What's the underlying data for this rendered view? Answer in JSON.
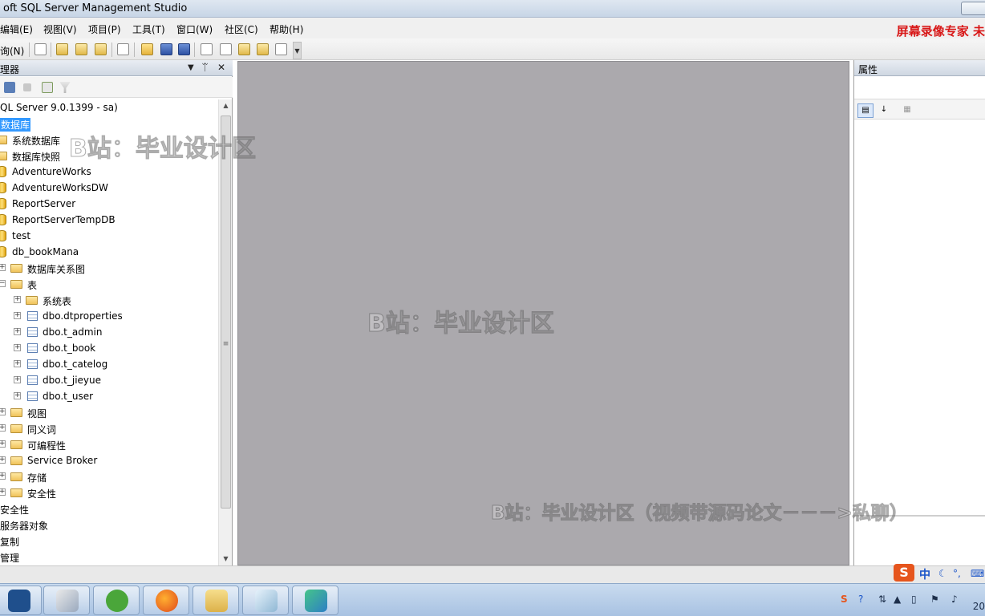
{
  "window": {
    "title": "oft SQL Server Management Studio"
  },
  "menu": {
    "items": [
      "编辑(E)",
      "视图(V)",
      "项目(P)",
      "工具(T)",
      "窗口(W)",
      "社区(C)",
      "帮助(H)"
    ],
    "promo": "屏幕录像专家 未"
  },
  "toolbar": {
    "query_label": "询(N)"
  },
  "explorer": {
    "title": "理器",
    "controls": {
      "dropdown": "▼",
      "pin": "ᛠ",
      "close": "✕"
    },
    "tree": [
      {
        "text": "QL Server 9.0.1399 - sa)"
      },
      {
        "text": "数据库"
      },
      {
        "text": "系统数据库"
      },
      {
        "text": "数据库快照"
      },
      {
        "text": "AdventureWorks"
      },
      {
        "text": "AdventureWorksDW"
      },
      {
        "text": "ReportServer"
      },
      {
        "text": "ReportServerTempDB"
      },
      {
        "text": "test"
      },
      {
        "text": "db_bookMana"
      },
      {
        "text": "数据库关系图"
      },
      {
        "text": "表"
      },
      {
        "text": "系统表"
      },
      {
        "text": "dbo.dtproperties"
      },
      {
        "text": "dbo.t_admin"
      },
      {
        "text": "dbo.t_book"
      },
      {
        "text": "dbo.t_catelog"
      },
      {
        "text": "dbo.t_jieyue"
      },
      {
        "text": "dbo.t_user"
      },
      {
        "text": "视图"
      },
      {
        "text": "同义词"
      },
      {
        "text": "可编程性"
      },
      {
        "text": "Service Broker"
      },
      {
        "text": "存储"
      },
      {
        "text": "安全性"
      },
      {
        "text": "安全性"
      },
      {
        "text": "服务器对象"
      },
      {
        "text": "复制"
      },
      {
        "text": "管理"
      }
    ]
  },
  "properties": {
    "title": "属性"
  },
  "watermarks": {
    "top_left": "B站：毕业设计区",
    "center": "B站：毕业设计区",
    "bottom": "B站：毕业设计区（视频带源码论文－－－>私聊）"
  },
  "ime": {
    "logo": "S",
    "mode": "中"
  },
  "taskbar": {
    "apps": [
      "start-app",
      "tools-app",
      "green-app",
      "firefox-app",
      "explorer-app",
      "notepad-app",
      "file-app"
    ],
    "clock": "20"
  },
  "colors": {
    "selection": "#3399ff",
    "promo": "#d81818",
    "document_bg": "#aba9ad"
  }
}
